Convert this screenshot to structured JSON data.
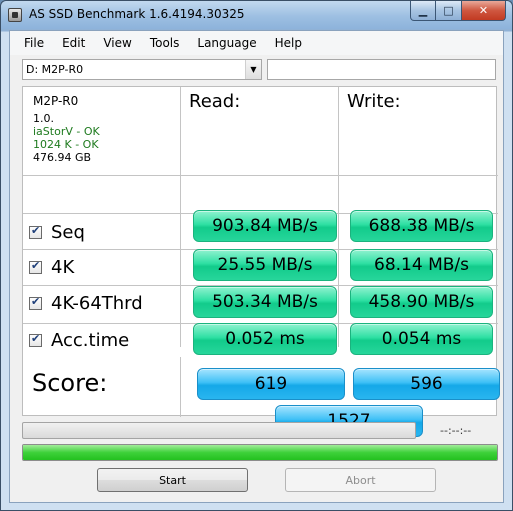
{
  "window": {
    "title": "AS SSD Benchmark 1.6.4194.30325"
  },
  "menu": [
    "File",
    "Edit",
    "View",
    "Tools",
    "Language",
    "Help"
  ],
  "drive_select": {
    "value": "D: M2P-R0"
  },
  "drive_info": {
    "name": "M2P-R0",
    "version": "1.0.",
    "driver": "iaStorV - OK",
    "alignment": "1024 K - OK",
    "size": "476.94 GB"
  },
  "columns": {
    "read": "Read:",
    "write": "Write:"
  },
  "tests": [
    {
      "label": "Seq",
      "read": "903.84 MB/s",
      "write": "688.38 MB/s"
    },
    {
      "label": "4K",
      "read": "25.55 MB/s",
      "write": "68.14 MB/s"
    },
    {
      "label": "4K-64Thrd",
      "read": "503.34 MB/s",
      "write": "458.90 MB/s"
    },
    {
      "label": "Acc.time",
      "read": "0.052 ms",
      "write": "0.054 ms"
    }
  ],
  "score": {
    "label": "Score:",
    "read": "619",
    "write": "596",
    "total": "1527"
  },
  "progress": {
    "time": "--:--:--",
    "test_fraction": 0,
    "overall_fraction": 1
  },
  "buttons": {
    "start": "Start",
    "abort": "Abort"
  },
  "colors": {
    "result": "#22db9a",
    "score": "#2bb6f0",
    "progress": "#36cc33"
  }
}
